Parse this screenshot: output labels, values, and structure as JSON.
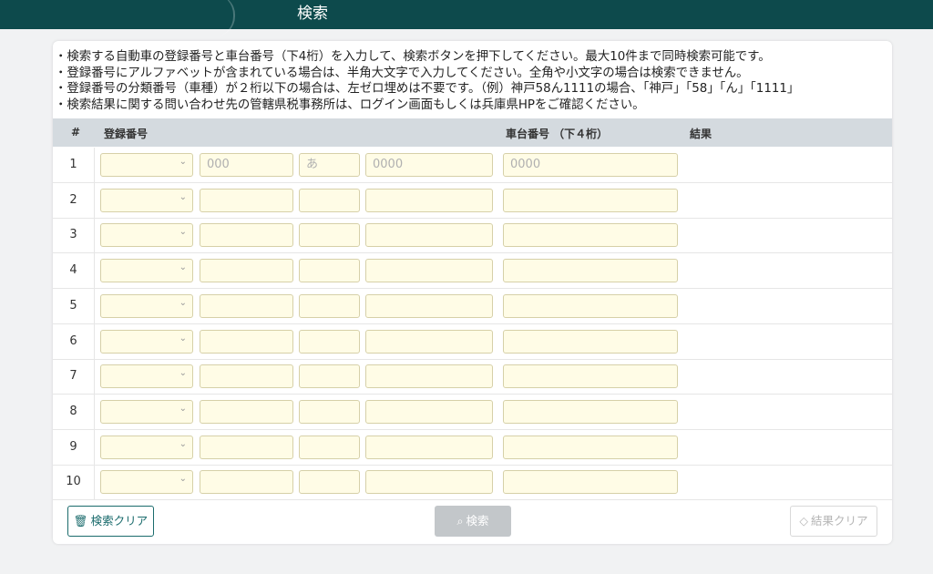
{
  "header": {
    "title": "検索"
  },
  "notes": [
    "・検索する自動車の登録番号と車台番号（下4桁）を入力して、検索ボタンを押下してください。最大10件まで同時検索可能です。",
    "・登録番号にアルファベットが含まれている場合は、半角大文字で入力してください。全角や小文字の場合は検索できません。",
    "・登録番号の分類番号（車種）が２桁以下の場合は、左ゼロ埋めは不要です。（例）神戸58ん1111の場合、「神戸」「58」「ん」「1111」",
    "・検索結果に関する問い合わせ先の管轄県税事務所は、ログイン画面もしくは兵庫県HPをご確認ください。"
  ],
  "table": {
    "headers": {
      "num": "#",
      "reg": "登録番号",
      "chassis": "車台番号 （下４桁）",
      "result": "結果"
    },
    "placeholders": {
      "class_no": "000",
      "kana": "あ",
      "serial": "0000",
      "chassis": "0000"
    },
    "rows": [
      "1",
      "2",
      "3",
      "4",
      "5",
      "6",
      "7",
      "8",
      "9",
      "10"
    ]
  },
  "buttons": {
    "search_clear": "検索クリア",
    "search": "検索",
    "result_clear": "結果クリア"
  },
  "icons": {
    "search_clear": "trash-icon",
    "search": "magnifier-icon",
    "result_clear": "eraser-icon"
  }
}
